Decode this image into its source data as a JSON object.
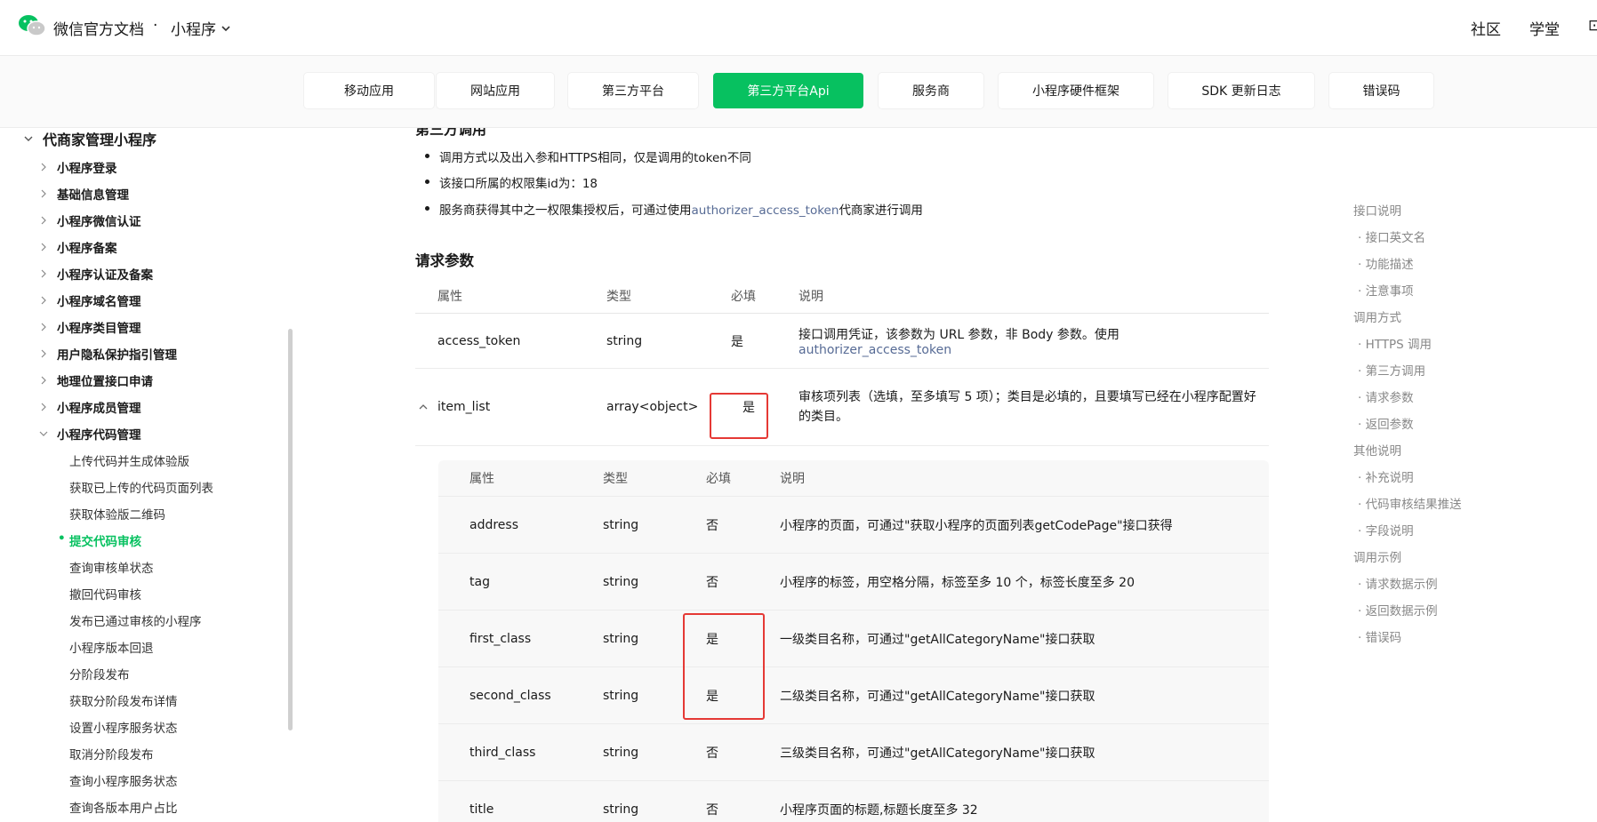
{
  "topbar": {
    "brand": "微信官方文档",
    "dot": "·",
    "product": "小程序",
    "community": "社区",
    "academy": "学堂",
    "edge_glyph": "⊡"
  },
  "tabs": [
    {
      "label": "移动应用",
      "active": false
    },
    {
      "label": "网站应用",
      "active": false
    },
    {
      "label": "第三方平台",
      "active": false
    },
    {
      "label": "第三方平台Api",
      "active": true
    },
    {
      "label": "服务商",
      "active": false
    },
    {
      "label": "小程序硬件框架",
      "active": false
    },
    {
      "label": "SDK 更新日志",
      "active": false
    },
    {
      "label": "错误码",
      "active": false
    }
  ],
  "sidebar": {
    "parent": "代商家管理小程序",
    "groups": [
      "小程序登录",
      "基础信息管理",
      "小程序微信认证",
      "小程序备案",
      "小程序认证及备案",
      "小程序域名管理",
      "小程序类目管理",
      "用户隐私保护指引管理",
      "地理位置接口申请",
      "小程序成员管理",
      "小程序代码管理"
    ],
    "leaves": [
      "上传代码并生成体验版",
      "获取已上传的代码页面列表",
      "获取体验版二维码",
      "提交代码审核",
      "查询审核单状态",
      "撤回代码审核",
      "发布已通过审核的小程序",
      "小程序版本回退",
      "分阶段发布",
      "获取分阶段发布详情",
      "设置小程序服务状态",
      "取消分阶段发布",
      "查询小程序服务状态",
      "查询各版本用户占比"
    ],
    "active_leaf": "提交代码审核"
  },
  "content": {
    "heading_partial": "第三方调用",
    "bullets": [
      {
        "text": "调用方式以及出入参和HTTPS相同，仅是调用的token不同"
      },
      {
        "text": "该接口所属的权限集id为：18"
      },
      {
        "pre": "服务商获得其中之一权限集授权后，可通过使用",
        "link": "authorizer_access_token",
        "post": "代商家进行调用"
      }
    ],
    "params_title": "请求参数",
    "headers": {
      "name": "属性",
      "type": "类型",
      "required": "必填",
      "desc": "说明"
    },
    "rows": [
      {
        "name": "access_token",
        "type": "string",
        "required": "是",
        "desc": "接口调用凭证，该参数为 URL 参数，非 Body 参数。使用",
        "desc_link": "authorizer_access_token"
      },
      {
        "name": "item_list",
        "type": "array<object>",
        "required": "是",
        "desc": "审核项列表（选填，至多填写 5 项）；类目是必填的，且要填写已经在小程序配置好的类目。"
      }
    ],
    "sub_rows": [
      {
        "name": "address",
        "type": "string",
        "required": "否",
        "desc": "小程序的页面，可通过\"获取小程序的页面列表getCodePage\"接口获得"
      },
      {
        "name": "tag",
        "type": "string",
        "required": "否",
        "desc": "小程序的标签，用空格分隔，标签至多 10 个，标签长度至多 20"
      },
      {
        "name": "first_class",
        "type": "string",
        "required": "是",
        "desc": "一级类目名称，可通过\"getAllCategoryName\"接口获取"
      },
      {
        "name": "second_class",
        "type": "string",
        "required": "是",
        "desc": "二级类目名称，可通过\"getAllCategoryName\"接口获取"
      },
      {
        "name": "third_class",
        "type": "string",
        "required": "否",
        "desc": "三级类目名称，可通过\"getAllCategoryName\"接口获取"
      },
      {
        "name": "title",
        "type": "string",
        "required": "否",
        "desc": "小程序页面的标题,标题长度至多 32"
      }
    ]
  },
  "toc": [
    {
      "label": "接口说明",
      "level": 1
    },
    {
      "label": "· 接口英文名",
      "level": 2
    },
    {
      "label": "· 功能描述",
      "level": 2
    },
    {
      "label": "· 注意事项",
      "level": 2
    },
    {
      "label": "调用方式",
      "level": 1
    },
    {
      "label": "· HTTPS 调用",
      "level": 2
    },
    {
      "label": "· 第三方调用",
      "level": 2
    },
    {
      "label": "· 请求参数",
      "level": 2
    },
    {
      "label": "· 返回参数",
      "level": 2
    },
    {
      "label": "其他说明",
      "level": 1
    },
    {
      "label": "· 补充说明",
      "level": 2
    },
    {
      "label": "· 代码审核结果推送",
      "level": 2
    },
    {
      "label": "· 字段说明",
      "level": 2
    },
    {
      "label": "调用示例",
      "level": 1
    },
    {
      "label": "· 请求数据示例",
      "level": 2
    },
    {
      "label": "· 返回数据示例",
      "level": 2
    },
    {
      "label": "· 错误码",
      "level": 2
    }
  ],
  "colors": {
    "accent": "#07c160",
    "link": "#576b95",
    "highlight": "#e53935"
  }
}
